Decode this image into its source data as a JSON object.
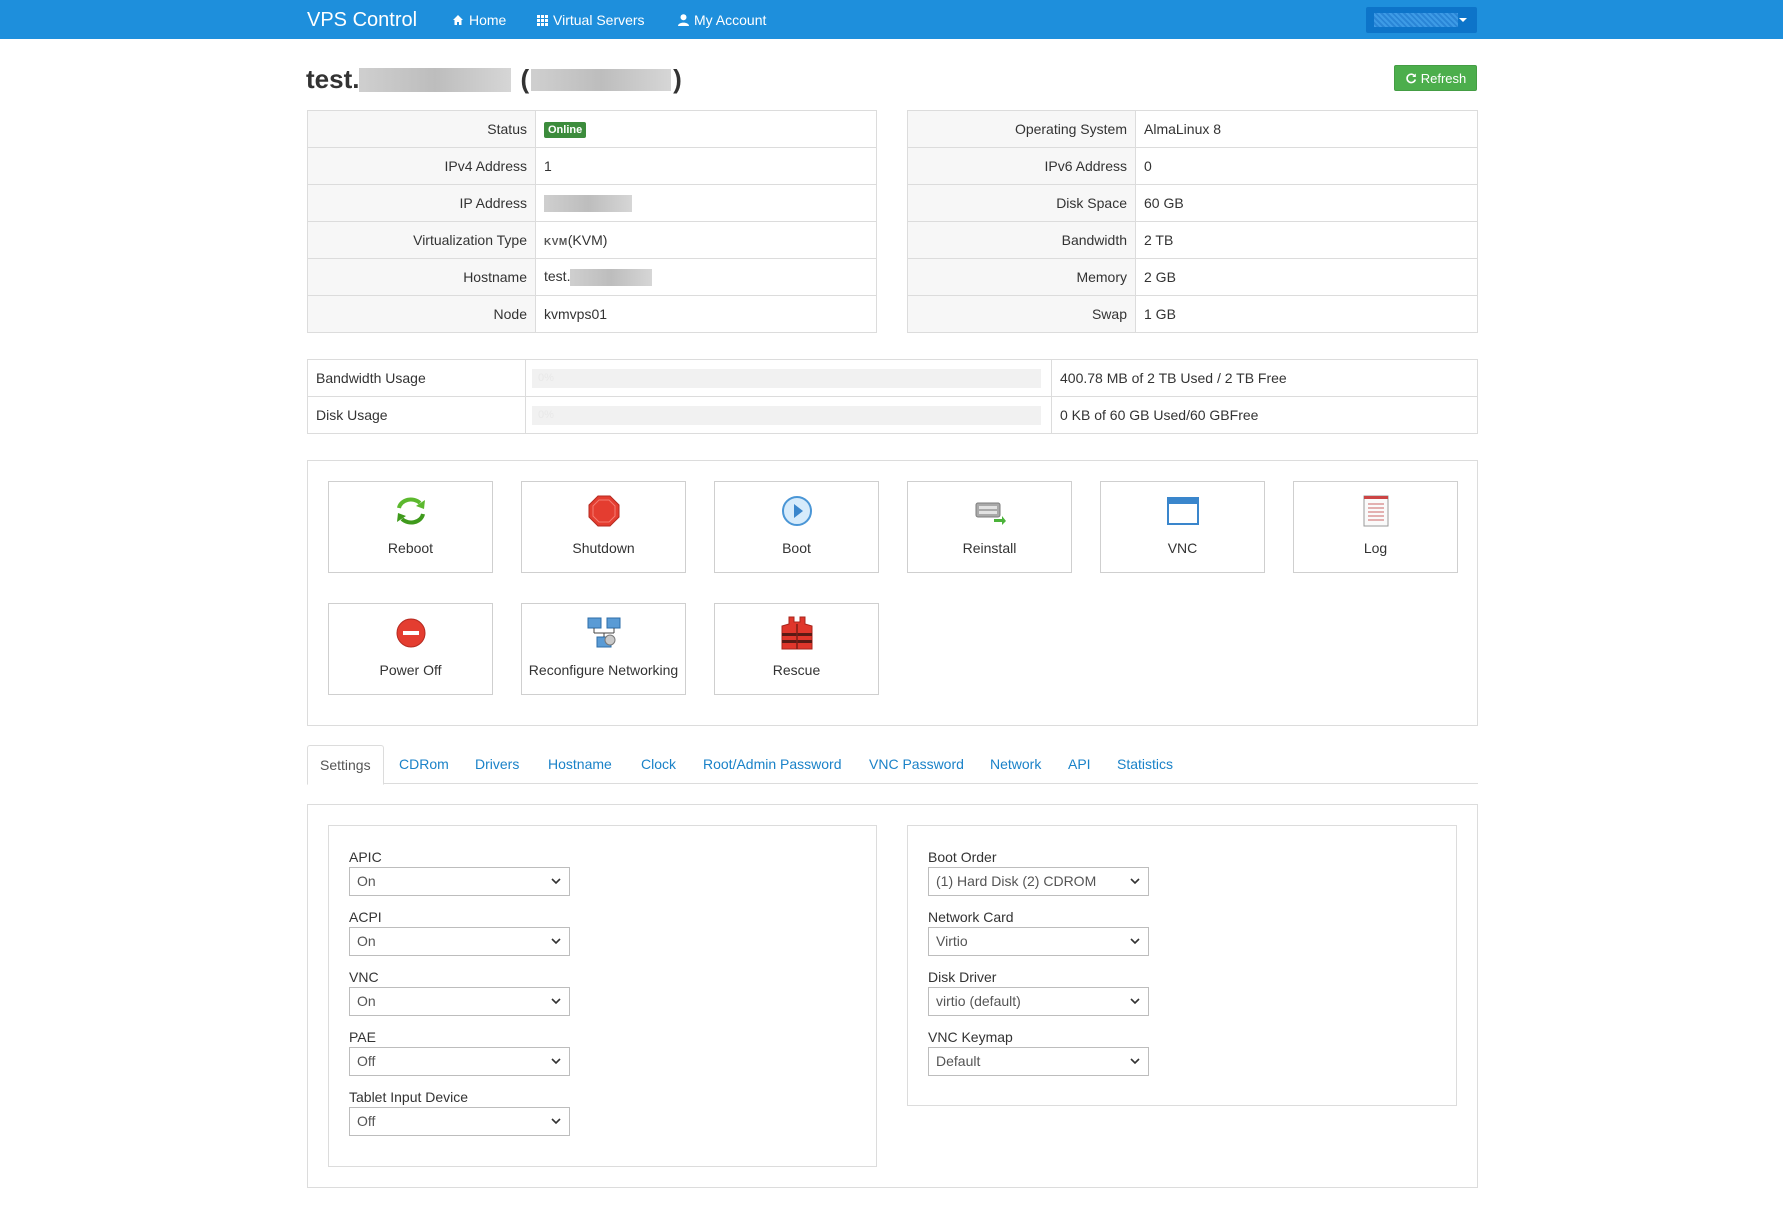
{
  "navbar": {
    "brand": "VPS Control",
    "links": [
      {
        "label": "Home",
        "icon": "home-icon"
      },
      {
        "label": "Virtual Servers",
        "icon": "grid-icon"
      },
      {
        "label": "My Account",
        "icon": "user-icon"
      }
    ]
  },
  "header": {
    "title_prefix": "test.",
    "refresh_label": "Refresh"
  },
  "left_info": [
    {
      "label": "Status",
      "value": "Online"
    },
    {
      "label": "IPv4 Address",
      "value": "1"
    },
    {
      "label": "IP Address",
      "value": ""
    },
    {
      "label": "Virtualization Type",
      "value": "(KVM)",
      "logo": "KVM"
    },
    {
      "label": "Hostname",
      "value": "test."
    },
    {
      "label": "Node",
      "value": "kvmvps01"
    }
  ],
  "right_info": [
    {
      "label": "Operating System",
      "value": "AlmaLinux 8"
    },
    {
      "label": "IPv6 Address",
      "value": "0"
    },
    {
      "label": "Disk Space",
      "value": "60 GB"
    },
    {
      "label": "Bandwidth",
      "value": "2 TB"
    },
    {
      "label": "Memory",
      "value": "2 GB"
    },
    {
      "label": "Swap",
      "value": "1 GB"
    }
  ],
  "usage": [
    {
      "label": "Bandwidth Usage",
      "percent": 0,
      "percent_text": "0%",
      "summary": "400.78 MB of 2 TB Used / 2 TB Free"
    },
    {
      "label": "Disk Usage",
      "percent": 0,
      "percent_text": "0%",
      "summary": "0 KB of 60 GB Used/60 GBFree"
    }
  ],
  "actions": [
    {
      "label": "Reboot",
      "icon": "reboot-icon"
    },
    {
      "label": "Shutdown",
      "icon": "shutdown-icon"
    },
    {
      "label": "Boot",
      "icon": "boot-icon"
    },
    {
      "label": "Reinstall",
      "icon": "reinstall-icon"
    },
    {
      "label": "VNC",
      "icon": "vnc-icon"
    },
    {
      "label": "Log",
      "icon": "log-icon"
    },
    {
      "label": "Power Off",
      "icon": "power-off-icon"
    },
    {
      "label": "Reconfigure Networking",
      "icon": "network-icon"
    },
    {
      "label": "Rescue",
      "icon": "rescue-icon"
    }
  ],
  "tabs": [
    "Settings",
    "CDRom",
    "Drivers",
    "Hostname",
    "Clock",
    "Root/Admin Password",
    "VNC Password",
    "Network",
    "API",
    "Statistics"
  ],
  "active_tab": "Settings",
  "settings_left": [
    {
      "label": "APIC",
      "value": "On"
    },
    {
      "label": "ACPI",
      "value": "On"
    },
    {
      "label": "VNC",
      "value": "On"
    },
    {
      "label": "PAE",
      "value": "Off"
    },
    {
      "label": "Tablet Input Device",
      "value": "Off"
    }
  ],
  "settings_right": [
    {
      "label": "Boot Order",
      "value": "(1) Hard Disk (2) CDROM"
    },
    {
      "label": "Network Card",
      "value": "Virtio"
    },
    {
      "label": "Disk Driver",
      "value": "virtio (default)"
    },
    {
      "label": "VNC Keymap",
      "value": "Default"
    }
  ],
  "colors": {
    "navbar": "#1e8fdc",
    "refresh": "#4cae4c",
    "online": "#3c8c3c",
    "link": "#1a82c8"
  }
}
